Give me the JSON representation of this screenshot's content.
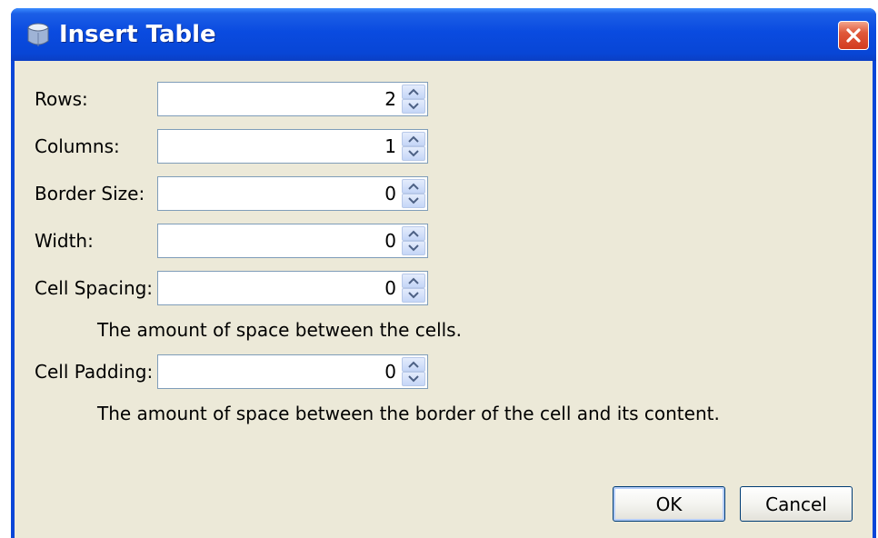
{
  "window": {
    "title": "Insert Table"
  },
  "fields": [
    {
      "label": "Rows:",
      "value": "2"
    },
    {
      "label": "Columns:",
      "value": "1"
    },
    {
      "label": "Border Size:",
      "value": "0"
    },
    {
      "label": "Width:",
      "value": "0"
    },
    {
      "label": "Cell Spacing:",
      "value": "0"
    },
    {
      "label": "Cell Padding:",
      "value": "0"
    }
  ],
  "hints": {
    "cell_spacing": "The amount of space between the cells.",
    "cell_padding": "The amount of space between the border of the cell and its content."
  },
  "buttons": {
    "ok": "OK",
    "cancel": "Cancel"
  },
  "colors": {
    "titlebar": "#0846d6",
    "dialog_background": "#ece9d8",
    "close_button": "#d23b1f"
  },
  "icons": {
    "app": "java-cup-icon",
    "close": "close-icon",
    "spinner_up": "chevron-up-icon",
    "spinner_down": "chevron-down-icon"
  }
}
